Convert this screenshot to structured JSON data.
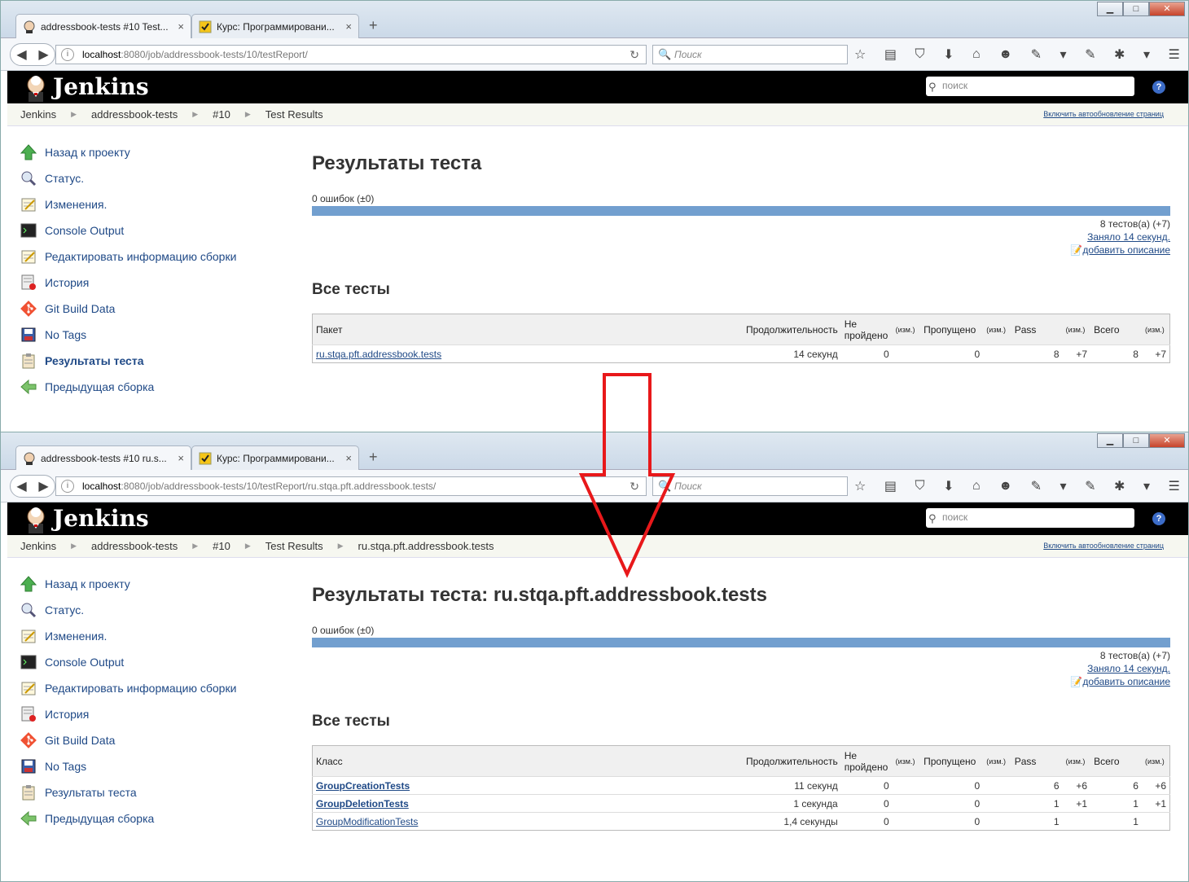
{
  "browser": {
    "search_placeholder": "Поиск",
    "window_controls": [
      "minimize-icon",
      "maximize-icon",
      "close-icon"
    ],
    "new_tab_label": "+"
  },
  "top": {
    "tabs": [
      {
        "label": "addressbook-tests #10 Test...",
        "close": "×"
      },
      {
        "label": "Курс: Программировани...",
        "close": "×"
      }
    ],
    "url_host": "localhost",
    "url_path": ":8080/job/addressbook-tests/10/testReport/",
    "breadcrumbs": [
      "Jenkins",
      "addressbook-tests",
      "#10",
      "Test Results"
    ],
    "title": "Результаты теста",
    "table": {
      "first_header": "Пакет",
      "rows": [
        {
          "name": "ru.stqa.pft.addressbook.tests",
          "duration": "14 секунд",
          "failed": "0",
          "failed_diff": "",
          "skipped": "0",
          "skipped_diff": "",
          "pass": "8",
          "pass_diff": "+7",
          "total": "8",
          "total_diff": "+7",
          "bold": false
        }
      ]
    }
  },
  "bottom": {
    "tabs": [
      {
        "label": "addressbook-tests #10 ru.s...",
        "close": "×"
      },
      {
        "label": "Курс: Программировани...",
        "close": "×"
      }
    ],
    "url_host": "localhost",
    "url_path": ":8080/job/addressbook-tests/10/testReport/ru.stqa.pft.addressbook.tests/",
    "breadcrumbs": [
      "Jenkins",
      "addressbook-tests",
      "#10",
      "Test Results",
      "ru.stqa.pft.addressbook.tests"
    ],
    "title": "Результаты теста: ru.stqa.pft.addressbook.tests",
    "table": {
      "first_header": "Класс",
      "rows": [
        {
          "name": "GroupCreationTests",
          "duration": "11 секунд",
          "failed": "0",
          "failed_diff": "",
          "skipped": "0",
          "skipped_diff": "",
          "pass": "6",
          "pass_diff": "+6",
          "total": "6",
          "total_diff": "+6",
          "bold": true
        },
        {
          "name": "GroupDeletionTests",
          "duration": "1 секунда",
          "failed": "0",
          "failed_diff": "",
          "skipped": "0",
          "skipped_diff": "",
          "pass": "1",
          "pass_diff": "+1",
          "total": "1",
          "total_diff": "+1",
          "bold": true
        },
        {
          "name": "GroupModificationTests",
          "duration": "1,4 секунды",
          "failed": "0",
          "failed_diff": "",
          "skipped": "0",
          "skipped_diff": "",
          "pass": "1",
          "pass_diff": "",
          "total": "1",
          "total_diff": "",
          "bold": false
        }
      ]
    }
  },
  "jenkins": {
    "brand": "Jenkins",
    "search_placeholder": "поиск",
    "help": "?",
    "autorefresh": "Включить автообновление страниц"
  },
  "sidebar": {
    "items": [
      {
        "label": "Назад к проекту",
        "icon": "up-arrow-icon"
      },
      {
        "label": "Статус.",
        "icon": "magnifier-icon"
      },
      {
        "label": "Изменения.",
        "icon": "notepad-icon"
      },
      {
        "label": "Console Output",
        "icon": "terminal-icon"
      },
      {
        "label": "Редактировать информацию сборки",
        "icon": "notepad-edit-icon"
      },
      {
        "label": "История",
        "icon": "history-icon"
      },
      {
        "label": "Git Build Data",
        "icon": "git-icon"
      },
      {
        "label": "No Tags",
        "icon": "save-icon"
      },
      {
        "label": "Результаты теста",
        "icon": "clipboard-icon"
      },
      {
        "label": "Предыдущая сборка",
        "icon": "left-arrow-icon"
      }
    ]
  },
  "summary": {
    "failures": "0 ошибок (±0)",
    "tests": "8 тестов(а) (+7)",
    "took": "Заняло 14 секунд.",
    "add_description": "добавить описание",
    "all_tests_heading": "Все тесты",
    "progress_fraction": 1.0
  },
  "table_headers": {
    "duration": "Продолжительность",
    "failed": "Не пройдено",
    "diff": "(изм.)",
    "skipped": "Пропущено",
    "pass": "Pass",
    "total": "Всего"
  },
  "colors": {
    "jenkins_header": "#000000",
    "progress_pass": "#729fcf",
    "link": "#204a87",
    "annotation_arrow": "#e8181a"
  }
}
